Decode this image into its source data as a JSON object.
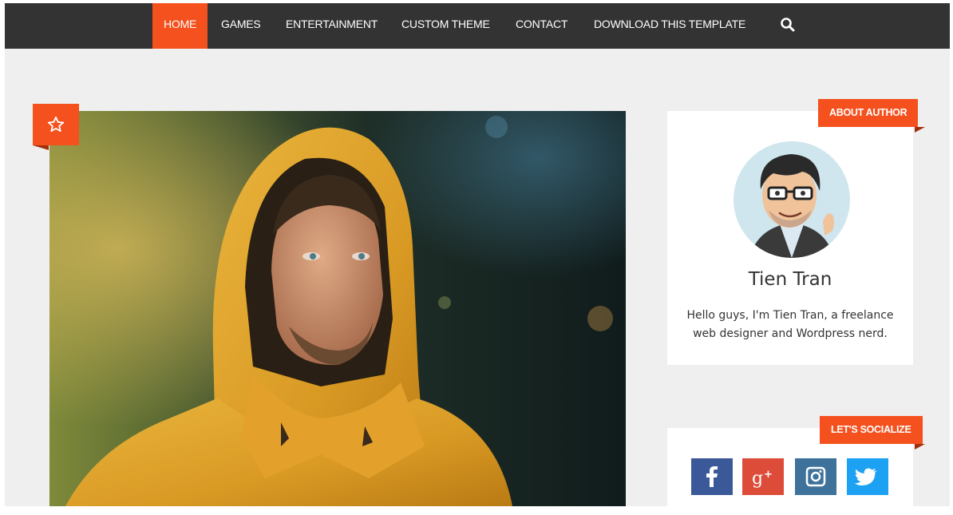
{
  "nav": {
    "items": [
      {
        "label": "HOME",
        "active": true
      },
      {
        "label": "GAMES"
      },
      {
        "label": "ENTERTAINMENT"
      },
      {
        "label": "CUSTOM THEME"
      },
      {
        "label": "CONTACT"
      },
      {
        "label": "DOWNLOAD THIS TEMPLATE"
      }
    ],
    "search_icon": "search-icon"
  },
  "featured": {
    "badge_icon": "star-icon",
    "image": "photo of a man in a yellow hooded jacket"
  },
  "about_widget": {
    "title": "ABOUT AUTHOR",
    "name": "Tien Tran",
    "bio": "Hello guys, I'm Tien Tran, a freelance web designer and Wordpress nerd."
  },
  "social_widget": {
    "title": "LET'S SOCIALIZE",
    "buttons": [
      {
        "network": "facebook",
        "icon": "facebook-icon",
        "color": "#3b5998"
      },
      {
        "network": "google-plus",
        "icon": "google-plus-icon",
        "color": "#dd4b39"
      },
      {
        "network": "instagram",
        "icon": "instagram-icon",
        "color": "#3f729b"
      },
      {
        "network": "twitter",
        "icon": "twitter-icon",
        "color": "#1da1f2"
      }
    ]
  },
  "colors": {
    "accent": "#f4511e",
    "navbar": "#333333",
    "page_bg": "#efefef"
  }
}
